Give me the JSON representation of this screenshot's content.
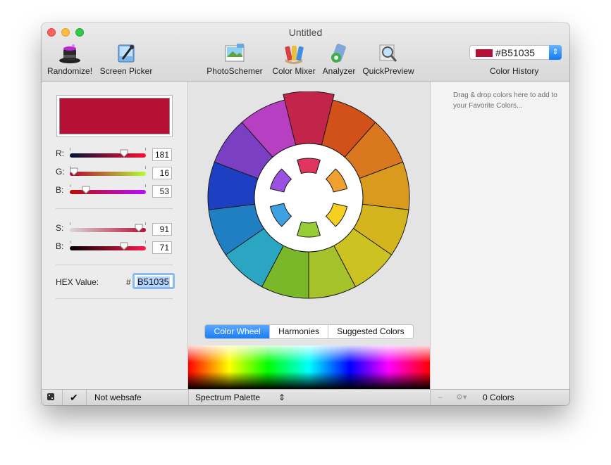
{
  "window": {
    "title": "Untitled"
  },
  "toolbar": {
    "randomize": {
      "label": "Randomize!",
      "icon": "magic-hat-icon"
    },
    "screen_picker": {
      "label": "Screen Picker",
      "icon": "eyedropper-icon"
    },
    "photoschemer": {
      "label": "PhotoSchemer",
      "icon": "photo-icon"
    },
    "color_mixer": {
      "label": "Color Mixer",
      "icon": "paint-tubes-icon"
    },
    "analyzer": {
      "label": "Analyzer",
      "icon": "analyzer-icon"
    },
    "quickpreview": {
      "label": "QuickPreview",
      "icon": "magnifier-icon"
    },
    "history": {
      "value": "#B51035",
      "swatch": "#B51035",
      "label": "Color History"
    }
  },
  "sliders": {
    "r": {
      "label": "R:",
      "value": "181",
      "level": 0.71
    },
    "g": {
      "label": "G:",
      "value": "16",
      "level": 0.06
    },
    "b": {
      "label": "B:",
      "value": "53",
      "level": 0.21
    },
    "s": {
      "label": "S:",
      "value": "91",
      "level": 0.91
    },
    "br": {
      "label": "B:",
      "value": "71",
      "level": 0.71
    }
  },
  "hex": {
    "label": "HEX Value:",
    "hash": "#",
    "value": "B51035"
  },
  "current_color": "#B51035",
  "tabs": [
    "Color Wheel",
    "Harmonies",
    "Suggested Colors"
  ],
  "active_tab": "Color Wheel",
  "favorites": {
    "hint": "Drag & drop colors here to add to your Favorite Colors..."
  },
  "status": {
    "websafe": "Not websafe",
    "palette": "Spectrum Palette",
    "colors_count": "0 Colors"
  },
  "wheel_colors": [
    "#c2244a",
    "#d2501a",
    "#d9781e",
    "#d99a1e",
    "#d4b51e",
    "#ccc322",
    "#a6c22a",
    "#7ab82a",
    "#2aa6c2",
    "#1f7fc2",
    "#1f3fc2",
    "#7a3fc2",
    "#b63fc2"
  ],
  "inner_colors": [
    "#e0355e",
    "#f0a030",
    "#f5d020",
    "#96cc36",
    "#3da0e0",
    "#9a50e0"
  ]
}
